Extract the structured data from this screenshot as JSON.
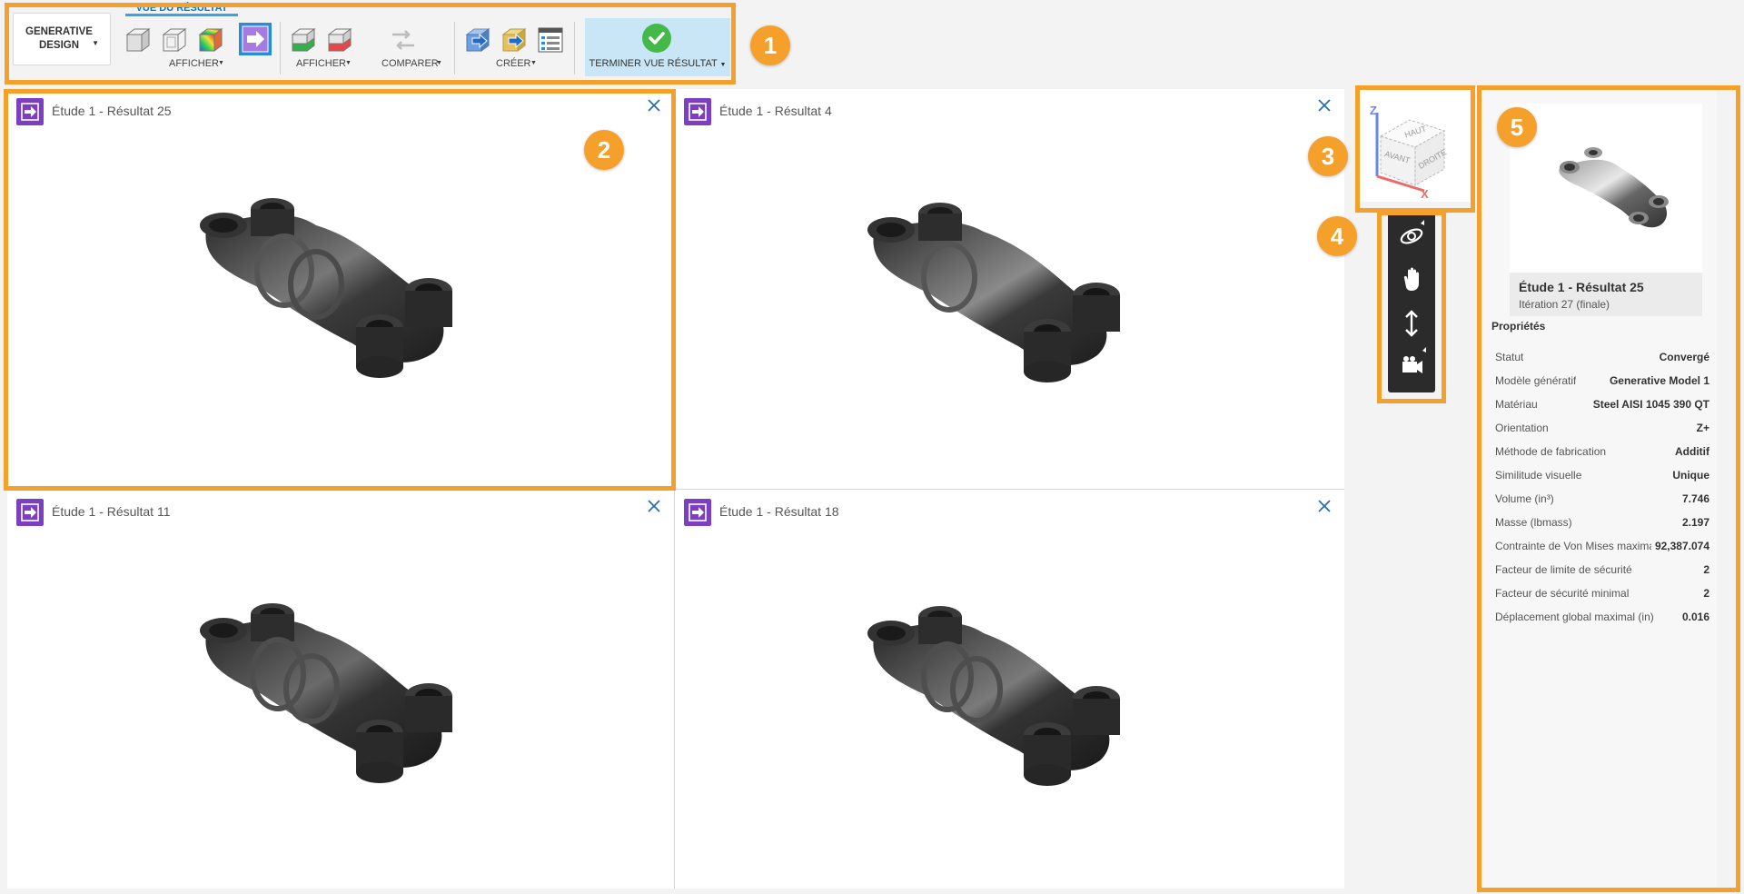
{
  "toolbar": {
    "workspace_button": "GENERATIVE DESIGN",
    "active_tab": "VUE DU RÉSULTAT",
    "groups": {
      "afficher_1": "AFFICHER",
      "afficher_2": "AFFICHER",
      "comparer": "COMPARER",
      "creer": "CRÉER",
      "terminer": "TERMINER VUE RÉSULTAT"
    },
    "icons": [
      "solid-box-icon",
      "wireframe-box-icon",
      "color-map-icon",
      "export-result-icon",
      "green-box-icon",
      "red-box-icon",
      "compare-arrows-icon",
      "create-blue-arrow-icon",
      "create-yellow-arrow-icon",
      "properties-list-icon",
      "check-icon"
    ]
  },
  "callouts": [
    "1",
    "2",
    "3",
    "4",
    "5"
  ],
  "viewports": [
    {
      "title": "Étude 1 - Résultat 25",
      "close_icon": "close-icon"
    },
    {
      "title": "Étude 1 - Résultat 4",
      "close_icon": "close-icon"
    },
    {
      "title": "Étude 1 - Résultat 11",
      "close_icon": "close-icon"
    },
    {
      "title": "Étude 1 - Résultat 18",
      "close_icon": "close-icon"
    }
  ],
  "viewcube": {
    "faces": {
      "top": "HAUT",
      "front": "AVANT",
      "right": "DROITE"
    },
    "axes": {
      "z": "Z",
      "x": "X"
    }
  },
  "navbar": [
    "orbit-icon",
    "pan-hand-icon",
    "zoom-icon",
    "camera-icon"
  ],
  "panel": {
    "thumb_title": "Étude 1 - Résultat 25",
    "thumb_subtitle": "Itération 27 (finale)",
    "properties_heading": "Propriétés",
    "properties": [
      {
        "label": "Statut",
        "value": "Convergé"
      },
      {
        "label": "Modèle génératif",
        "value": "Generative Model 1"
      },
      {
        "label": "Matériau",
        "value": "Steel AISI 1045 390 QT"
      },
      {
        "label": "Orientation",
        "value": "Z+"
      },
      {
        "label": "Méthode de fabrication",
        "value": "Additif"
      },
      {
        "label": "Similitude visuelle",
        "value": "Unique"
      },
      {
        "label": "Volume (in³)",
        "value": "7.746"
      },
      {
        "label": "Masse (lbmass)",
        "value": "2.197"
      },
      {
        "label": "Contrainte de Von Mises maximale",
        "value": "92,387.074"
      },
      {
        "label": "Facteur de limite de sécurité",
        "value": "2"
      },
      {
        "label": "Facteur de sécurité minimal",
        "value": "2"
      },
      {
        "label": "Déplacement global maximal (in)",
        "value": "0.016"
      }
    ]
  },
  "colors": {
    "callout": "#f5a02a",
    "accent": "#0a79c2",
    "viewport_icon": "#7b3fc4",
    "finish_bg": "#c9e6f6"
  }
}
